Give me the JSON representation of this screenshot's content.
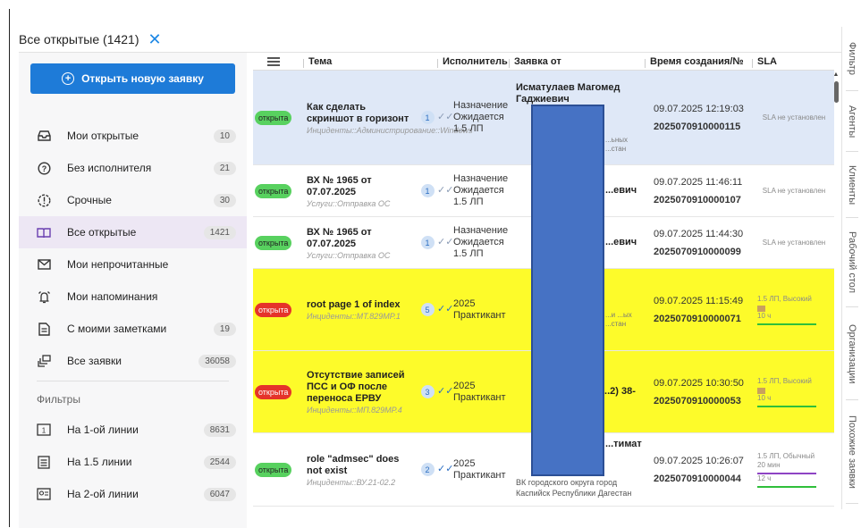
{
  "tab": {
    "title": "Все открытые (1421)",
    "close": "✕"
  },
  "sidebar": {
    "new_button": "Открыть новую заявку",
    "items": [
      {
        "label": "Мои открытые",
        "count": "10"
      },
      {
        "label": "Без исполнителя",
        "count": "21"
      },
      {
        "label": "Срочные",
        "count": "30"
      },
      {
        "label": "Все открытые",
        "count": "1421"
      },
      {
        "label": "Мои непрочитанные",
        "count": ""
      },
      {
        "label": "Мои напоминания",
        "count": ""
      },
      {
        "label": "С моими заметками",
        "count": "19"
      },
      {
        "label": "Все заявки",
        "count": "36058"
      }
    ],
    "filters_label": "Фильтры",
    "filters": [
      {
        "label": "На 1-ой линии",
        "count": "8631"
      },
      {
        "label": "На 1.5 линии",
        "count": "2544"
      },
      {
        "label": "На 2-ой линии",
        "count": "6047"
      }
    ]
  },
  "table": {
    "headers": {
      "topic": "Тема",
      "executor": "Исполнитель",
      "from": "Заявка от",
      "time": "Время создания/№",
      "sla": "SLA"
    },
    "rows": [
      {
        "status": "открыта",
        "topic": "Как сделать скриншот в горизонт",
        "sub": "Инциденты::Администрирование::Windows",
        "n": "1",
        "exec": "Назначение Ожидается 1.5 ЛП",
        "from1": "Исматулаев Магомед Гаджиевич",
        "from2": "...ьных ...стан",
        "time": "09.07.2025 12:19:03",
        "id": "2025070910000115",
        "sla": "SLA не установлен"
      },
      {
        "status": "открыта",
        "topic": "ВХ № 1965 от 07.07.2025",
        "sub": "Услуги::Отправка ОС",
        "n": "1",
        "exec": "Назначение Ожидается 1.5 ЛП",
        "from1": "...евич",
        "from2": "",
        "time": "09.07.2025 11:46:11",
        "id": "2025070910000107",
        "sla": "SLA не установлен"
      },
      {
        "status": "открыта",
        "topic": "ВХ № 1965 от 07.07.2025",
        "sub": "Услуги::Отправка ОС",
        "n": "1",
        "exec": "Назначение Ожидается 1.5 ЛП",
        "from1": "...евич",
        "from2": "",
        "time": "09.07.2025 11:44:30",
        "id": "2025070910000099",
        "sla": "SLA не установлен"
      },
      {
        "status": "открыта",
        "topic": "root page 1 of index",
        "sub": "Инциденты::МТ.829МР.1",
        "n": "5",
        "exec": "2025 Практикант",
        "from1": "",
        "from2": "...и ...ых ...стан",
        "time": "09.07.2025 11:15:49",
        "id": "2025070910000071",
        "sla": "1.5 ЛП, Высокий",
        "sla2": "10 ч"
      },
      {
        "status": "открыта",
        "topic": "Отсутствие записей ПСС и ОФ после переноса ЕРВУ",
        "sub": "Инциденты::МП.829МР.4",
        "n": "3",
        "exec": "2025 Практикант",
        "from1": "...2) 38-",
        "from2": "",
        "time": "09.07.2025 10:30:50",
        "id": "2025070910000053",
        "sla": "1.5 ЛП, Высокий",
        "sla2": "10 ч"
      },
      {
        "status": "открыта",
        "topic": "role \"admsec\" does not exist",
        "sub": "Инциденты::ВУ.21-02.2",
        "n": "2",
        "exec": "2025 Практикант",
        "from1": "...тимат",
        "from2": "ВК городского округа город Каспийск Республики Дагестан",
        "time": "09.07.2025 10:26:07",
        "id": "2025070910000044",
        "sla": "1.5 ЛП, Обычный",
        "sla2": "20 мин",
        "sla3": "12 ч"
      }
    ]
  },
  "right_tabs": [
    "Фильтр",
    "Агенты",
    "Клиенты",
    "Рабочий стол",
    "Организации",
    "Похожие заявки"
  ],
  "colors": {
    "accent": "#1e7bd8",
    "highlight_yellow": "#fdfb2a",
    "highlight_blue": "#dfe8f7",
    "status_green": "#58d15f",
    "status_red": "#e5332a",
    "redaction": "#4672c4"
  }
}
